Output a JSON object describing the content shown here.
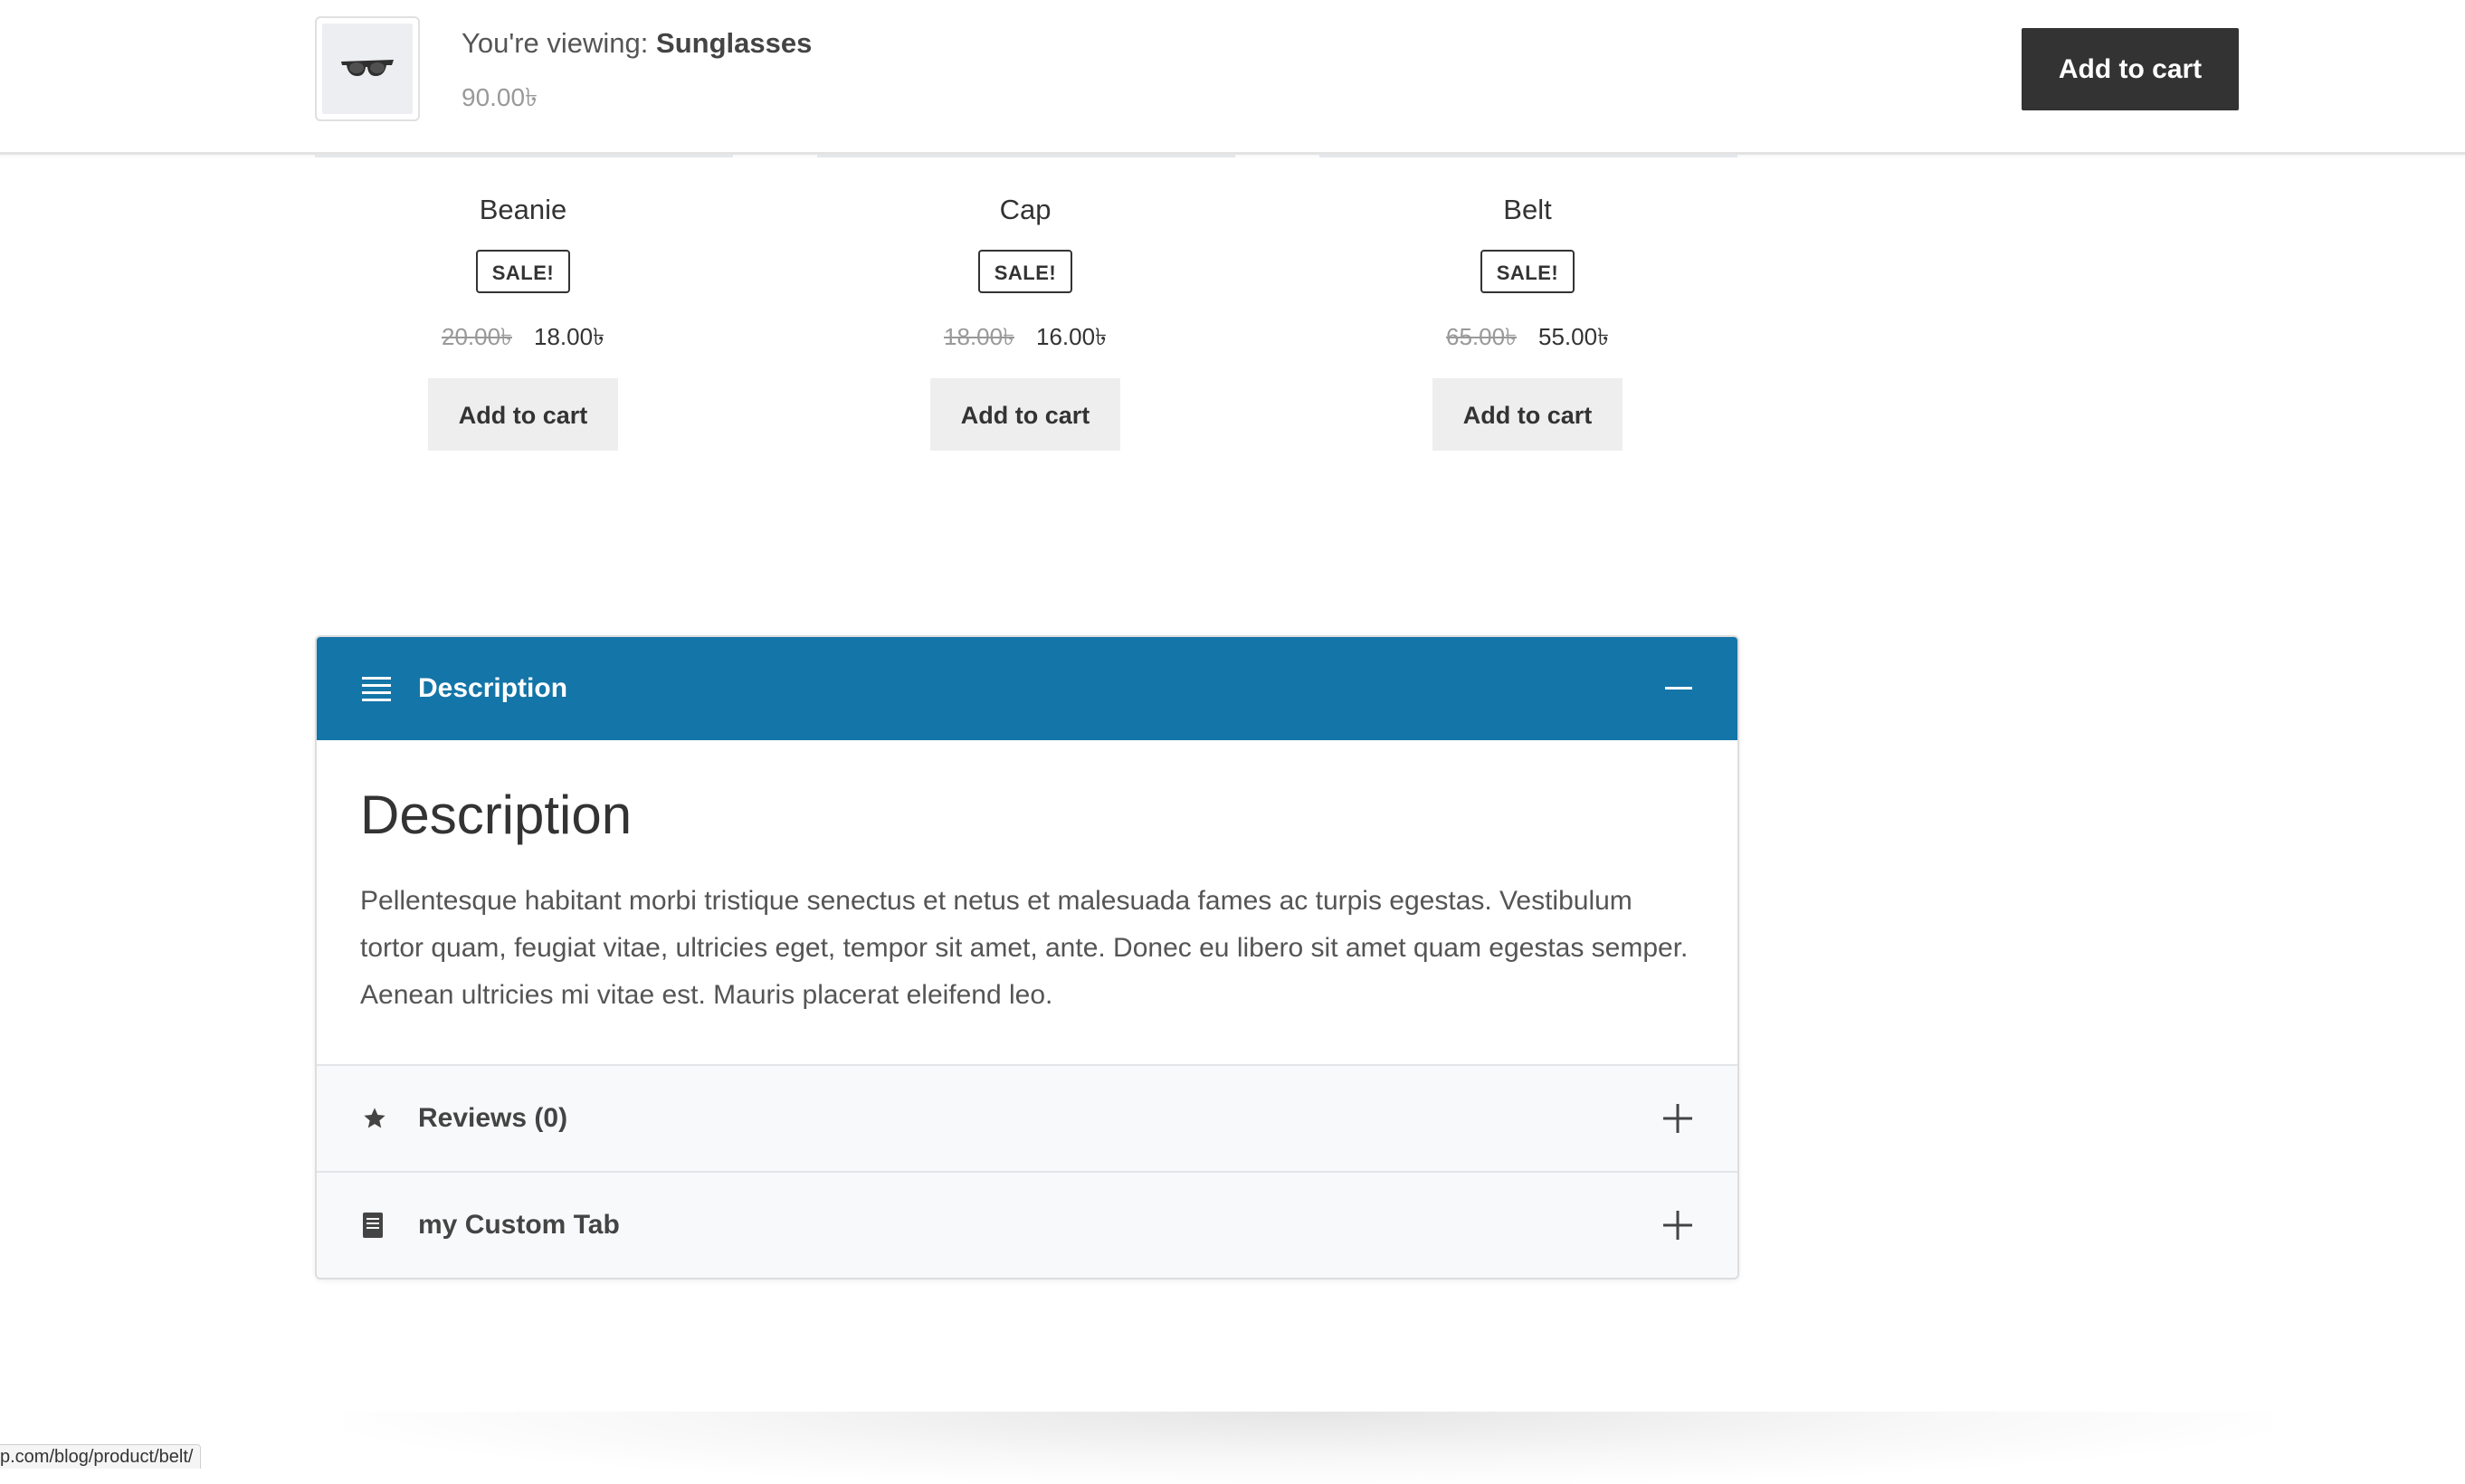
{
  "sticky": {
    "viewing_prefix": "You're viewing: ",
    "product_name": "Sunglasses",
    "price": "90.00৳",
    "add_to_cart": "Add to cart",
    "thumb_icon": "sunglasses-icon"
  },
  "products": [
    {
      "title": "Beanie",
      "badge": "SALE!",
      "old_price": "20.00৳",
      "new_price": "18.00৳",
      "add_to_cart": "Add to cart"
    },
    {
      "title": "Cap",
      "badge": "SALE!",
      "old_price": "18.00৳",
      "new_price": "16.00৳",
      "add_to_cart": "Add to cart"
    },
    {
      "title": "Belt",
      "badge": "SALE!",
      "old_price": "65.00৳",
      "new_price": "55.00৳",
      "add_to_cart": "Add to cart"
    }
  ],
  "tabs": {
    "description": {
      "label": "Description",
      "icon": "list-icon",
      "toggle_icon": "minus-icon",
      "heading": "Description",
      "text": "Pellentesque habitant morbi tristique senectus et netus et malesuada fames ac turpis egestas. Vestibulum tortor quam, feugiat vitae, ultricies eget, tempor sit amet, ante. Donec eu libero sit amet quam egestas semper. Aenean ultricies mi vitae est. Mauris placerat eleifend leo."
    },
    "reviews": {
      "label": "Reviews (0)",
      "icon": "star-icon",
      "toggle_icon": "plus-icon"
    },
    "custom": {
      "label": "my Custom Tab",
      "icon": "document-icon",
      "toggle_icon": "plus-icon"
    }
  },
  "accent_color": "#1475a8",
  "status_bar": {
    "url": "p.com/blog/product/belt/"
  }
}
